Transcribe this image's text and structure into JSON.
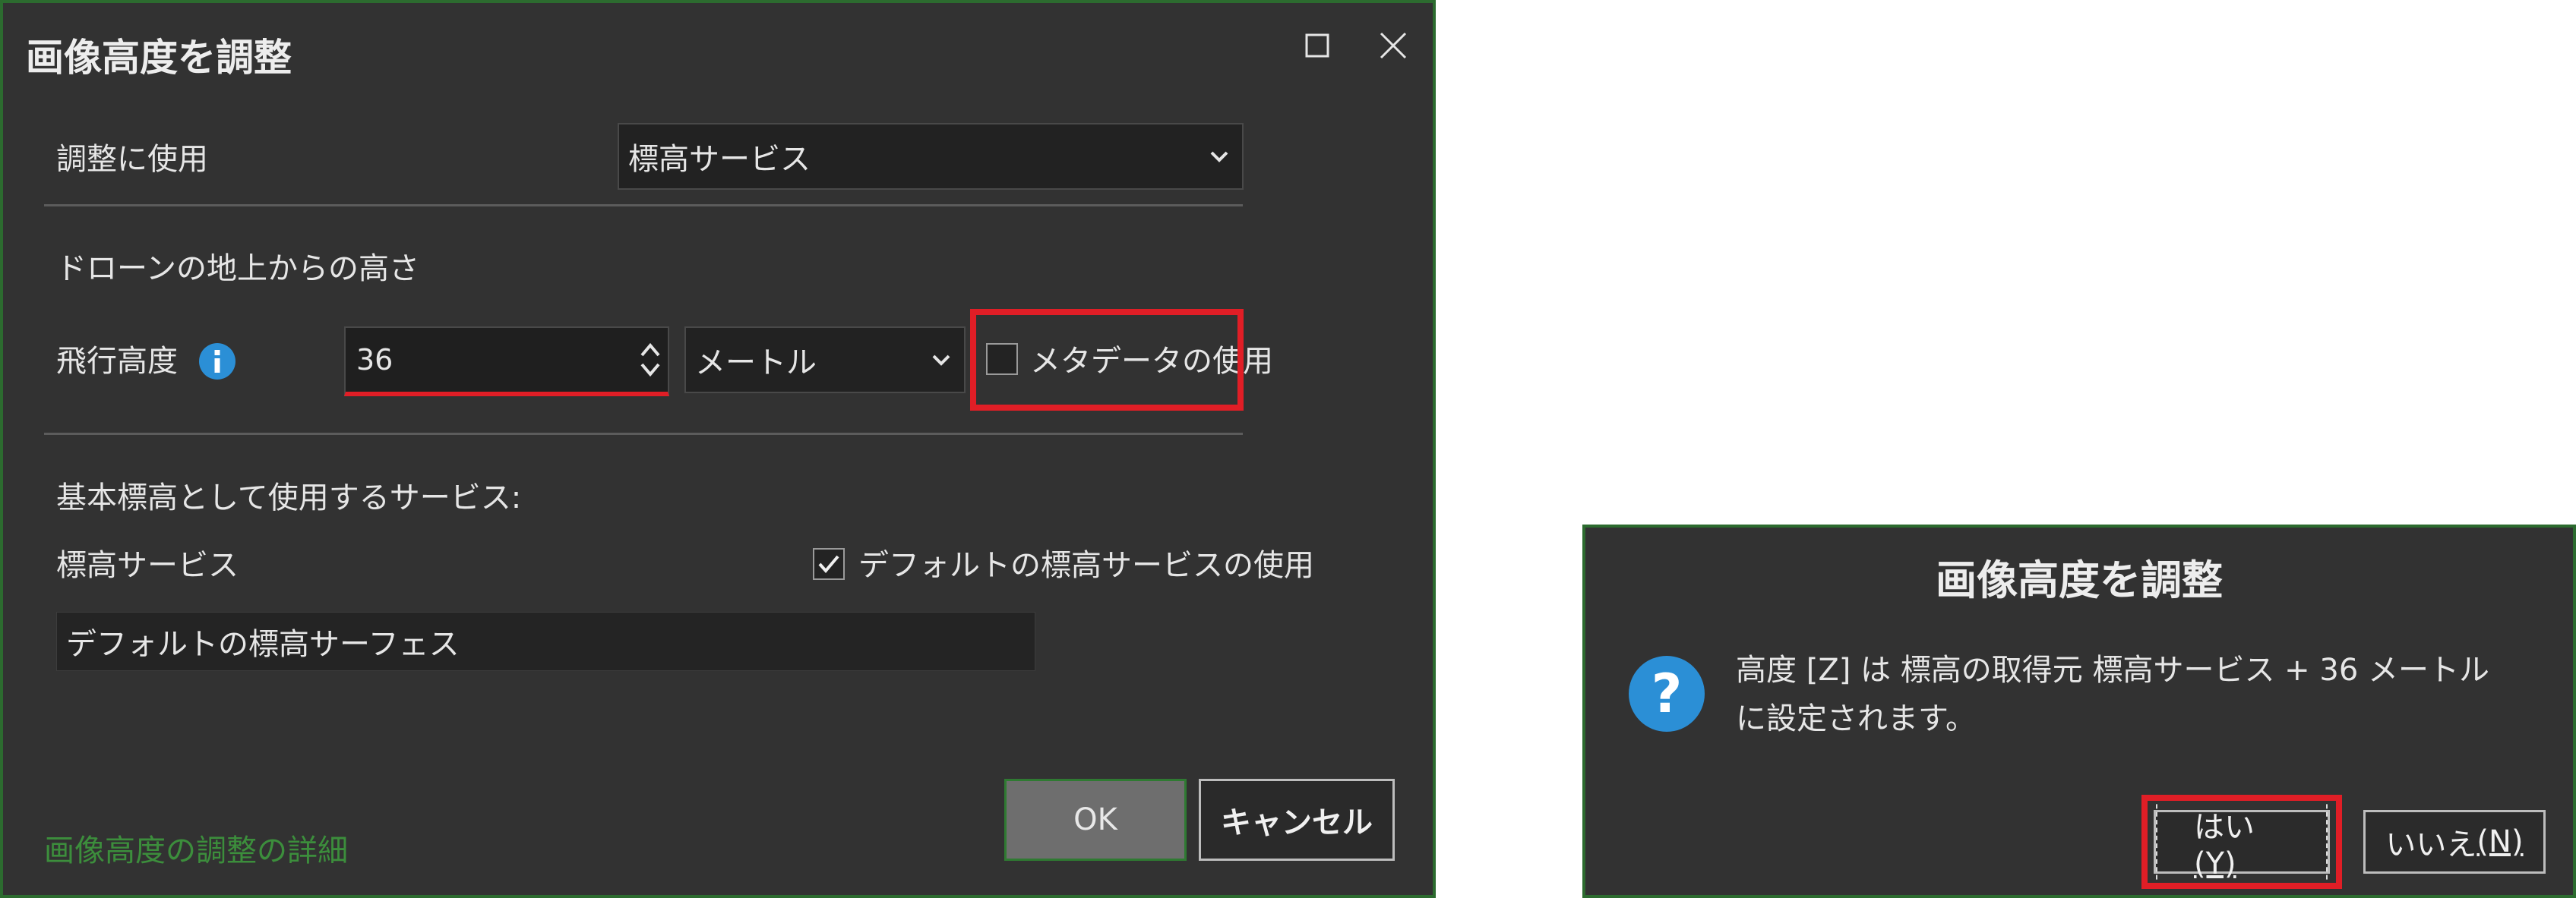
{
  "main_dialog": {
    "title": "画像高度を調整",
    "adjust_label": "調整に使用",
    "adjust_value": "標高サービス",
    "drone_section": "ドローンの地上からの高さ",
    "flight_altitude_label": "飛行高度",
    "flight_altitude_value": "36",
    "unit_value": "メートル",
    "metadata_label": "メタデータの使用",
    "metadata_checked": false,
    "base_section": "基本標高として使用するサービス:",
    "elevation_service_label": "標高サービス",
    "default_service_label": "デフォルトの標高サービスの使用",
    "default_service_checked": true,
    "surface_value": "デフォルトの標高サーフェス",
    "ok_label": "OK",
    "cancel_label": "キャンセル",
    "details_link": "画像高度の調整の詳細"
  },
  "confirm_dialog": {
    "title": "画像高度を調整",
    "message_line1": "高度 [Z] は 標高の取得元 標高サービス + 36 メートル",
    "message_line2": "に設定されます。",
    "yes_label": "はい",
    "yes_mnemonic": "(Y)",
    "no_label": "いいえ",
    "no_mnemonic": "(N)"
  },
  "colors": {
    "dialog_bg": "#323232",
    "dialog_border": "#2c6b2f",
    "highlight": "#e01e26",
    "info_icon": "#2b8fd6",
    "link": "#3c8e3c"
  },
  "icons": [
    "maximize-icon",
    "close-icon",
    "info-icon",
    "chevron-down-icon",
    "spinner-up-icon",
    "spinner-down-icon",
    "checkmark-icon",
    "question-icon"
  ]
}
